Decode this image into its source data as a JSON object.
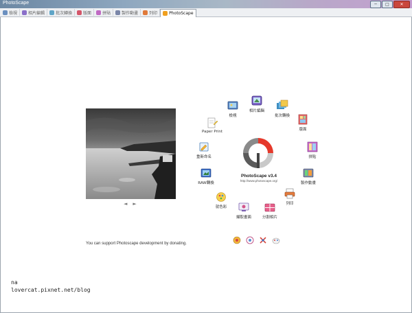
{
  "window": {
    "title": "PhotoScape",
    "buttons": [
      "─",
      "□",
      "✕"
    ]
  },
  "tabs": [
    {
      "label": "檢視",
      "color": "#6a8fbf",
      "icon": "viewer-icon"
    },
    {
      "label": "相片編輯",
      "color": "#8a6fc9",
      "icon": "editor-icon"
    },
    {
      "label": "批次轉換",
      "color": "#5fa5c7",
      "icon": "batch-icon"
    },
    {
      "label": "版面",
      "color": "#d4566a",
      "icon": "page-icon"
    },
    {
      "label": "拼貼",
      "color": "#c06ac4",
      "icon": "combine-icon"
    },
    {
      "label": "製作動畫",
      "color": "#7a86a8",
      "icon": "animated-gif-icon"
    },
    {
      "label": "列印",
      "color": "#e07a3a",
      "icon": "print-icon"
    },
    {
      "label": "PhotoScape",
      "color": "#f0a020",
      "icon": "home-icon"
    }
  ],
  "preview": {
    "nav_prev": "◄",
    "nav_next": "►"
  },
  "ring": {
    "viewer": "檢視",
    "editor": "相片編輯",
    "batch": "批次轉換",
    "page": "版面",
    "combine": "拼貼",
    "gif": "製作動畫",
    "print": "列印",
    "splitter": "分割相片",
    "capture": "擷取畫面",
    "colorpicker": "就色彩",
    "raw": "RAW轉換",
    "rename": "重新命名",
    "paperprint": "Paper Print"
  },
  "logo": {
    "name": "PhotoScape v3.4",
    "url": "http://www.photoscape.org/"
  },
  "donate_text": "You can support Photoscape development by donating.",
  "watermark": {
    "line1": "na",
    "line2": "lovercat.pixnet.net/blog"
  }
}
